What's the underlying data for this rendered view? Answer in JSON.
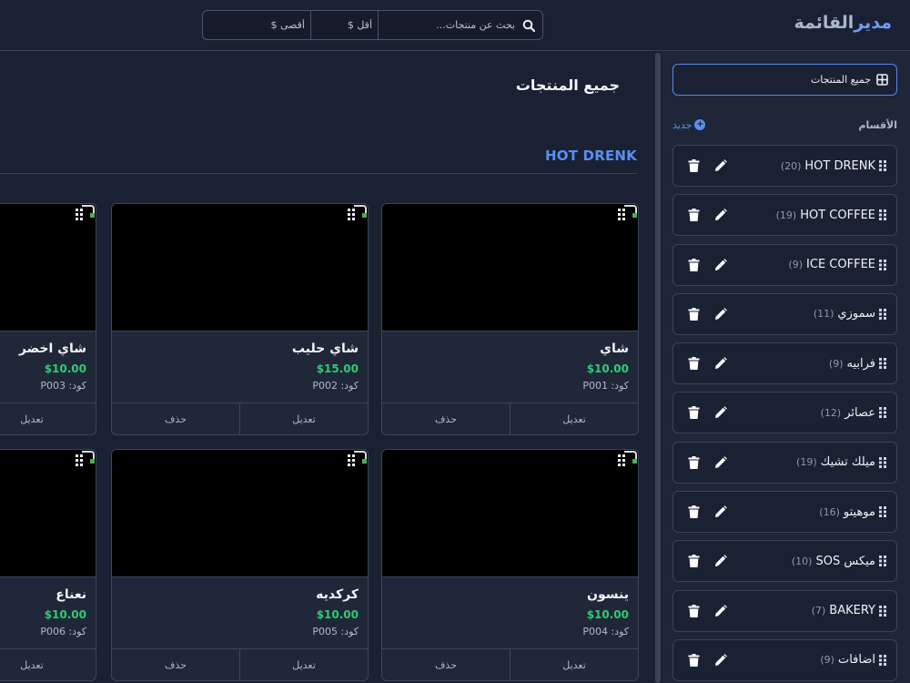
{
  "header": {
    "brand_part1": "مدير",
    "brand_part2": "القائمة",
    "search_placeholder": "بحث عن منتجات...",
    "min_price_placeholder": "أقل $",
    "max_price_placeholder": "أقصى $"
  },
  "sidebar": {
    "all_products_label": "جميع المنتجات",
    "categories_title": "الأقسام",
    "new_label": "جديد",
    "categories": [
      {
        "name": "HOT DRENK",
        "count": "(20)"
      },
      {
        "name": "HOT COFFEE",
        "count": "(19)"
      },
      {
        "name": "ICE COFFEE",
        "count": "(9)"
      },
      {
        "name": "سموزي",
        "count": "(11)"
      },
      {
        "name": "فرابيه",
        "count": "(9)"
      },
      {
        "name": "عصائر",
        "count": "(12)"
      },
      {
        "name": "ميلك تشيك",
        "count": "(19)"
      },
      {
        "name": "موهيتو",
        "count": "(16)"
      },
      {
        "name": "ميكس SOS",
        "count": "(10)"
      },
      {
        "name": "BAKERY",
        "count": "(7)"
      },
      {
        "name": "اضافات",
        "count": "(9)"
      }
    ]
  },
  "main": {
    "page_title": "جميع المنتجات",
    "section_title": "HOT DRENK",
    "edit_label": "تعديل",
    "delete_label": "حذف",
    "products": [
      {
        "name": "شاي",
        "price": "$10.00",
        "code": "كود: P001"
      },
      {
        "name": "شاي حليب",
        "price": "$15.00",
        "code": "كود: P002"
      },
      {
        "name": "شاي اخضر",
        "price": "$10.00",
        "code": "كود: P003"
      },
      {
        "name": "ينسون",
        "price": "$10.00",
        "code": "كود: P004"
      },
      {
        "name": "كركديه",
        "price": "$10.00",
        "code": "كود: P005"
      },
      {
        "name": "نعناع",
        "price": "$10.00",
        "code": "كود: P006"
      }
    ]
  },
  "colors": {
    "background": "#1a2133",
    "accent": "#5b8ef0",
    "price": "#2ecc71"
  },
  "icons": [
    "search-icon",
    "grid-icon",
    "plus-circle-icon",
    "grip-icon",
    "pencil-icon",
    "trash-icon"
  ]
}
